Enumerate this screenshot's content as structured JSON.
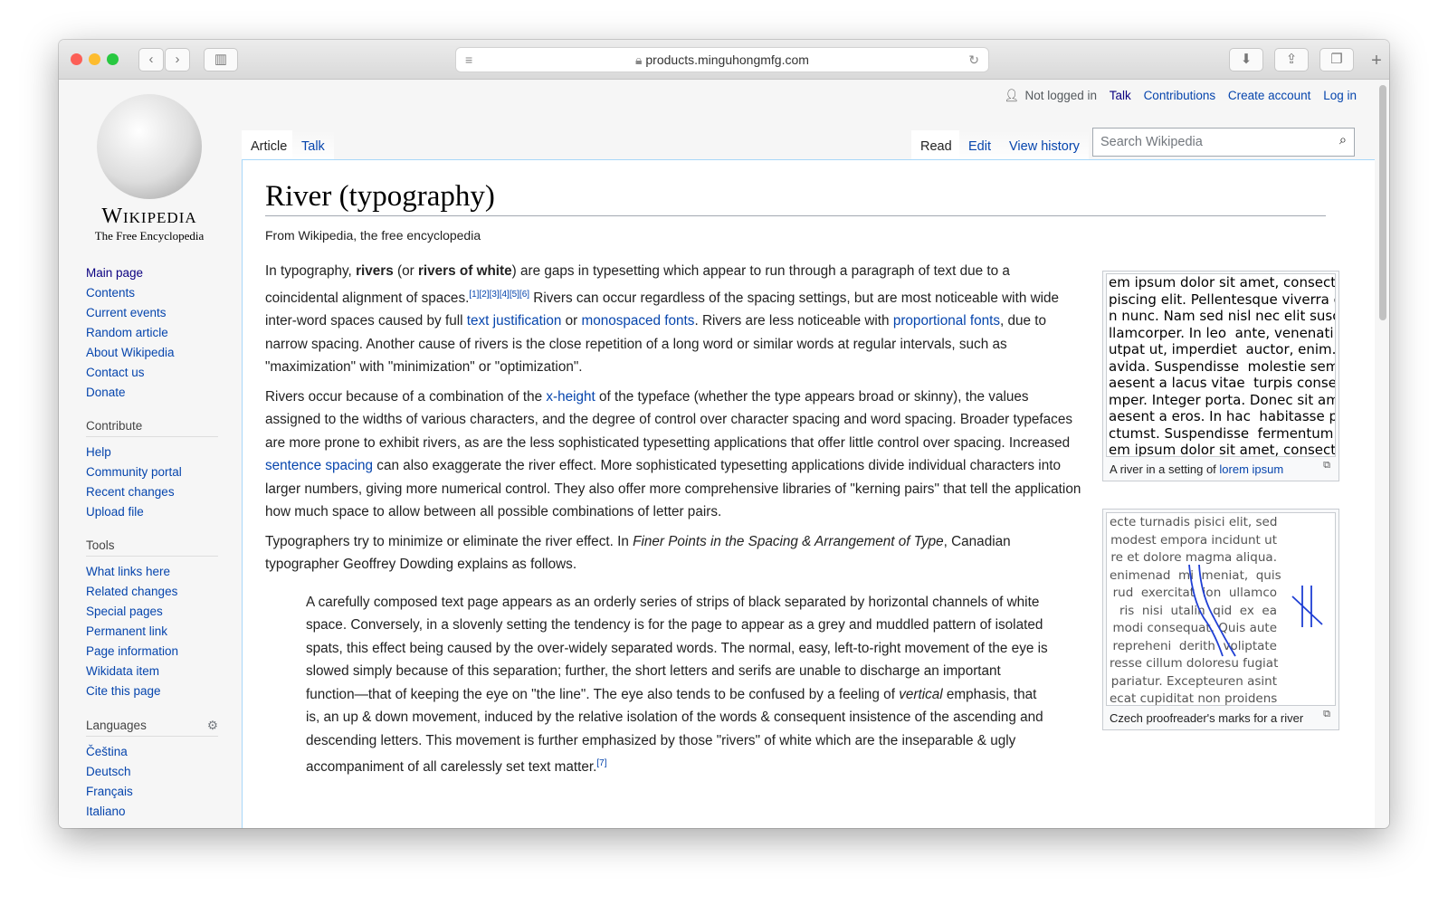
{
  "browser": {
    "url": "products.minguhongmfg.com"
  },
  "logo": {
    "wordmark": "Wikipedia",
    "tagline": "The Free Encyclopedia"
  },
  "personal": {
    "not_logged_in": "Not logged in",
    "talk": "Talk",
    "contributions": "Contributions",
    "create_account": "Create account",
    "log_in": "Log in"
  },
  "tabs": {
    "article": "Article",
    "talk": "Talk",
    "read": "Read",
    "edit": "Edit",
    "history": "View history"
  },
  "search": {
    "placeholder": "Search Wikipedia"
  },
  "nav": {
    "main": [
      "Main page",
      "Contents",
      "Current events",
      "Random article",
      "About Wikipedia",
      "Contact us",
      "Donate"
    ],
    "contribute_heading": "Contribute",
    "contribute": [
      "Help",
      "Community portal",
      "Recent changes",
      "Upload file"
    ],
    "tools_heading": "Tools",
    "tools": [
      "What links here",
      "Related changes",
      "Special pages",
      "Permanent link",
      "Page information",
      "Wikidata item",
      "Cite this page"
    ],
    "languages_heading": "Languages",
    "languages": [
      "Čeština",
      "Deutsch",
      "Français",
      "Italiano"
    ]
  },
  "article": {
    "title": "River (typography)",
    "from": "From Wikipedia, the free encyclopedia",
    "p1": {
      "a": "In typography, ",
      "b1": "rivers",
      "c": " (or ",
      "b2": "rivers of white",
      "d": ") are gaps in typesetting which appear to run through a paragraph of text due to a coincidental alignment of spaces.",
      "refs": "[1][2][3][4][5][6]",
      "e": " Rivers can occur regardless of the spacing settings, but are most noticeable with wide inter-word spaces caused by full ",
      "l1": "text justification",
      "f": " or ",
      "l2": "monospaced fonts",
      "g": ". Rivers are less noticeable with ",
      "l3": "proportional fonts",
      "h": ", due to narrow spacing. Another cause of rivers is the close repetition of a long word or similar words at regular intervals, such as \"maximization\" with \"minimization\" or \"optimization\"."
    },
    "p2": {
      "a": "Rivers occur because of a combination of the ",
      "l1": "x-height",
      "b": " of the typeface (whether the type appears broad or skinny), the values assigned to the widths of various characters, and the degree of control over character spacing and word spacing. Broader typefaces are more prone to exhibit rivers, as are the less sophisticated typesetting applications that offer little control over spacing. Increased ",
      "l2": "sentence spacing",
      "c": " can also exaggerate the river effect. More sophisticated typesetting applications divide individual characters into larger numbers, giving more numerical control. They also offer more comprehensive libraries of \"kerning pairs\" that tell the application how much space to allow between all possible combinations of letter pairs."
    },
    "p3": {
      "a": "Typographers try to minimize or eliminate the river effect. In ",
      "i": "Finer Points in the Spacing & Arrangement of Type",
      "b": ", Canadian typographer Geoffrey Dowding explains as follows."
    },
    "quote": {
      "a": "A carefully composed text page appears as an orderly series of strips of black separated by horizontal channels of white space. Conversely, in a slovenly setting the tendency is for the page to appear as a grey and muddled pattern of isolated spats, this effect being caused by the over-widely separated words. The normal, easy, left-to-right movement of the eye is slowed simply because of this separation; further, the short letters and serifs are unable to discharge an important function—that of keeping the eye on \"the line\". The eye also tends to be confused by a feeling of ",
      "i": "vertical",
      "b": " emphasis, that is, an up & down movement, induced by the relative isolation of the words & consequent insistence of the ascending and descending letters. This movement is further emphasized by those \"rivers\" of white which are the inseparable & ugly accompaniment of all carelessly set text matter.",
      "ref": "[7]"
    }
  },
  "figure1": {
    "lines": [
      "em ipsum dolor sit amet, consecte",
      "piscing elit. Pellentesque viverra c",
      "n nunc. Nam sed nisl nec elit susc",
      "llamcorper. In leo  ante, venenati",
      "utpat ut, imperdiet  auctor, enim. (",
      "avida. Suspendisse  molestie sem.",
      "aesent a lacus vitae  turpis consec",
      "mper. Integer porta. Donec sit am",
      "aesent a eros. In hac  habitasse pl",
      "ctumst. Suspendisse  fermentum.",
      "em ipsum dolor sit amet, consecte"
    ],
    "caption": "A river in a setting of ",
    "caption_link": "lorem ipsum"
  },
  "figure2": {
    "lines": [
      "ecte turnadis pisici elit, sed",
      "modest empora incidunt ut",
      "re et dolore magma aliqua.",
      "enimenad  mi  meniat,  quis",
      "rud  exercitat  ion  ullamco",
      "ris  nisi  utalin  qid  ex  ea",
      "modi consequat. Quis aute",
      "repreheni  derith  voliptate",
      "resse cillum doloresu fugiat",
      "pariatur. Excepteuren asint",
      "ecat cupiditat non proidens"
    ],
    "caption": "Czech proofreader's marks for a river"
  }
}
